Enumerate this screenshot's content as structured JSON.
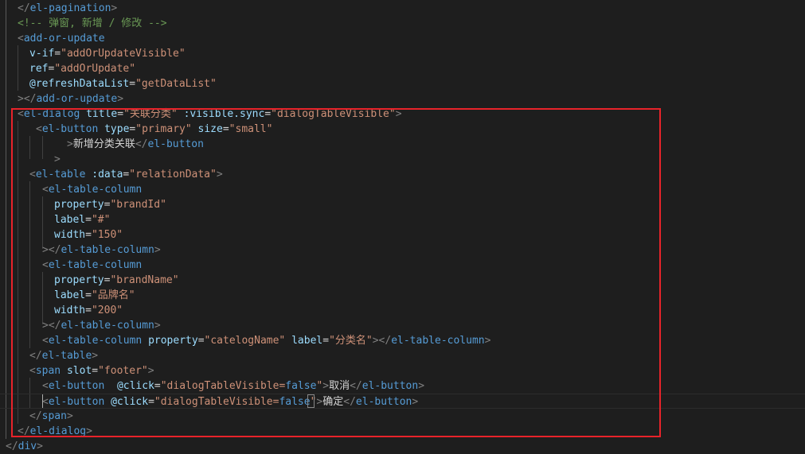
{
  "editor": {
    "lines": [
      {
        "segs": [
          [
            "t",
            "</"
          ],
          [
            "n",
            "el-pagination"
          ],
          [
            "t",
            ">"
          ]
        ]
      },
      {
        "segs": [
          [
            "c",
            "<!-- 弹窗, 新增 / 修改 -->"
          ]
        ]
      },
      {
        "segs": [
          [
            "t",
            "<"
          ],
          [
            "n",
            "add-or-update"
          ]
        ]
      },
      {
        "segs": [
          [
            "a",
            "v-if"
          ],
          [
            "x",
            "="
          ],
          [
            "s",
            "\"addOrUpdateVisible\""
          ]
        ]
      },
      {
        "segs": [
          [
            "a",
            "ref"
          ],
          [
            "x",
            "="
          ],
          [
            "s",
            "\"addOrUpdate\""
          ]
        ]
      },
      {
        "segs": [
          [
            "a",
            "@refreshDataList"
          ],
          [
            "x",
            "="
          ],
          [
            "s",
            "\"getDataList\""
          ]
        ]
      },
      {
        "segs": [
          [
            "t",
            "></"
          ],
          [
            "n",
            "add-or-update"
          ],
          [
            "t",
            ">"
          ]
        ]
      },
      {
        "segs": [
          [
            "t",
            "<"
          ],
          [
            "n",
            "el-dialog"
          ],
          [
            "x",
            " "
          ],
          [
            "a",
            "title"
          ],
          [
            "x",
            "="
          ],
          [
            "s",
            "\"关联分类\""
          ],
          [
            "x",
            " "
          ],
          [
            "a",
            ":visible.sync"
          ],
          [
            "x",
            "="
          ],
          [
            "s",
            "\"dialogTableVisible\""
          ],
          [
            "t",
            ">"
          ]
        ]
      },
      {
        "segs": [
          [
            "t",
            "<"
          ],
          [
            "n",
            "el-button"
          ],
          [
            "x",
            " "
          ],
          [
            "a",
            "type"
          ],
          [
            "x",
            "="
          ],
          [
            "s",
            "\"primary\""
          ],
          [
            "x",
            " "
          ],
          [
            "a",
            "size"
          ],
          [
            "x",
            "="
          ],
          [
            "s",
            "\"small\""
          ]
        ]
      },
      {
        "segs": [
          [
            "t",
            ">"
          ],
          [
            "x",
            "新增分类关联"
          ],
          [
            "t",
            "</"
          ],
          [
            "n",
            "el-button"
          ]
        ]
      },
      {
        "segs": [
          [
            "t",
            ">"
          ]
        ]
      },
      {
        "segs": [
          [
            "t",
            "<"
          ],
          [
            "n",
            "el-table"
          ],
          [
            "x",
            " "
          ],
          [
            "a",
            ":data"
          ],
          [
            "x",
            "="
          ],
          [
            "s",
            "\"relationData\""
          ],
          [
            "t",
            ">"
          ]
        ]
      },
      {
        "segs": [
          [
            "t",
            "<"
          ],
          [
            "n",
            "el-table-column"
          ]
        ]
      },
      {
        "segs": [
          [
            "a",
            "property"
          ],
          [
            "x",
            "="
          ],
          [
            "s",
            "\"brandId\""
          ]
        ]
      },
      {
        "segs": [
          [
            "a",
            "label"
          ],
          [
            "x",
            "="
          ],
          [
            "s",
            "\"#\""
          ]
        ]
      },
      {
        "segs": [
          [
            "a",
            "width"
          ],
          [
            "x",
            "="
          ],
          [
            "s",
            "\"150\""
          ]
        ]
      },
      {
        "segs": [
          [
            "t",
            "></"
          ],
          [
            "n",
            "el-table-column"
          ],
          [
            "t",
            ">"
          ]
        ]
      },
      {
        "segs": [
          [
            "t",
            "<"
          ],
          [
            "n",
            "el-table-column"
          ]
        ]
      },
      {
        "segs": [
          [
            "a",
            "property"
          ],
          [
            "x",
            "="
          ],
          [
            "s",
            "\"brandName\""
          ]
        ]
      },
      {
        "segs": [
          [
            "a",
            "label"
          ],
          [
            "x",
            "="
          ],
          [
            "s",
            "\"品牌名\""
          ]
        ]
      },
      {
        "segs": [
          [
            "a",
            "width"
          ],
          [
            "x",
            "="
          ],
          [
            "s",
            "\"200\""
          ]
        ]
      },
      {
        "segs": [
          [
            "t",
            "></"
          ],
          [
            "n",
            "el-table-column"
          ],
          [
            "t",
            ">"
          ]
        ]
      },
      {
        "segs": [
          [
            "t",
            "<"
          ],
          [
            "n",
            "el-table-column"
          ],
          [
            "x",
            " "
          ],
          [
            "a",
            "property"
          ],
          [
            "x",
            "="
          ],
          [
            "s",
            "\"catelogName\""
          ],
          [
            "x",
            " "
          ],
          [
            "a",
            "label"
          ],
          [
            "x",
            "="
          ],
          [
            "s",
            "\"分类名\""
          ],
          [
            "t",
            "></"
          ],
          [
            "n",
            "el-table-column"
          ],
          [
            "t",
            ">"
          ]
        ]
      },
      {
        "segs": [
          [
            "t",
            "</"
          ],
          [
            "n",
            "el-table"
          ],
          [
            "t",
            ">"
          ]
        ]
      },
      {
        "segs": [
          [
            "t",
            "<"
          ],
          [
            "n",
            "span"
          ],
          [
            "x",
            " "
          ],
          [
            "a",
            "slot"
          ],
          [
            "x",
            "="
          ],
          [
            "s",
            "\"footer\""
          ],
          [
            "t",
            ">"
          ]
        ]
      },
      {
        "segs": [
          [
            "t",
            "<"
          ],
          [
            "n",
            "el-button"
          ],
          [
            "x",
            "  "
          ],
          [
            "a",
            "@click"
          ],
          [
            "x",
            "="
          ],
          [
            "s",
            "\"dialogTableVisible="
          ],
          [
            "n",
            "false"
          ],
          [
            "s",
            "\""
          ],
          [
            "t",
            ">"
          ],
          [
            "x",
            "取消"
          ],
          [
            "t",
            "</"
          ],
          [
            "n",
            "el-button"
          ],
          [
            "t",
            ">"
          ]
        ]
      },
      {
        "segs": [
          [
            "t",
            "<"
          ],
          [
            "n",
            "el-button"
          ],
          [
            "x",
            " "
          ],
          [
            "a",
            "@click"
          ],
          [
            "x",
            "="
          ],
          [
            "s",
            "\"dialogTableVisible="
          ],
          [
            "n",
            "false"
          ],
          [
            "s",
            "\""
          ],
          [
            "t",
            ">"
          ],
          [
            "x",
            "确定"
          ],
          [
            "t",
            "</"
          ],
          [
            "n",
            "el-button"
          ],
          [
            "t",
            ">"
          ]
        ]
      },
      {
        "segs": [
          [
            "t",
            "</"
          ],
          [
            "n",
            "span"
          ],
          [
            "t",
            ">"
          ]
        ]
      },
      {
        "segs": [
          [
            "t",
            "</"
          ],
          [
            "n",
            "el-dialog"
          ],
          [
            "t",
            ">"
          ]
        ]
      },
      {
        "segs": [
          [
            "t",
            "</"
          ],
          [
            "n",
            "div"
          ],
          [
            "t",
            ">"
          ]
        ]
      }
    ]
  }
}
